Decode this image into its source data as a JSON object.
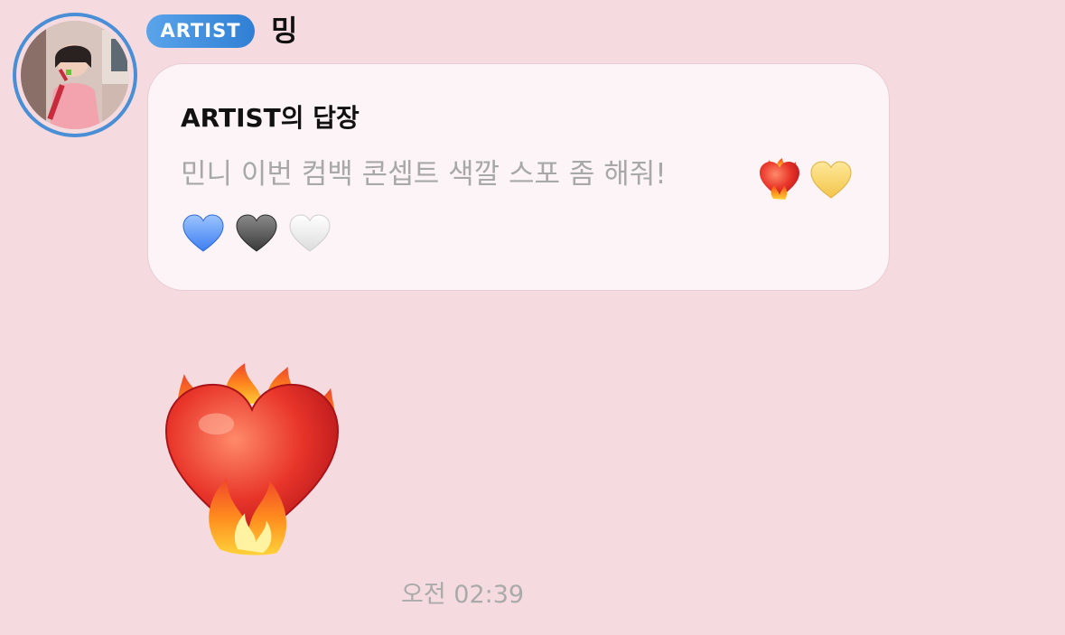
{
  "message": {
    "sender_badge": "ARTIST",
    "sender_name": "밍",
    "reply_title": "ARTIST의 답장",
    "reply_text": "민니 이번 컴백 콘셉트 색깔 스포 좀 해줘!",
    "reply_emojis": [
      "heart-on-fire",
      "yellow-heart",
      "blue-heart",
      "black-heart",
      "white-heart"
    ],
    "sent_emoji": "heart-on-fire",
    "timestamp": "오전 02:39"
  },
  "colors": {
    "background": "#f5dbe0",
    "badge": "#3b8ce0",
    "avatar_ring": "#4a8fd6",
    "bubble": "#fcf4f7",
    "muted_text": "#a8a8a8"
  }
}
